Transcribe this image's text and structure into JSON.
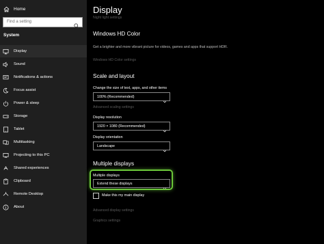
{
  "sidebar": {
    "home_label": "Home",
    "search_placeholder": "Find a setting",
    "section_title": "System",
    "items": [
      {
        "label": "Display",
        "icon": "monitor-icon"
      },
      {
        "label": "Sound",
        "icon": "speaker-icon"
      },
      {
        "label": "Notifications & actions",
        "icon": "notifications-icon"
      },
      {
        "label": "Focus assist",
        "icon": "moon-icon"
      },
      {
        "label": "Power & sleep",
        "icon": "power-icon"
      },
      {
        "label": "Storage",
        "icon": "storage-icon"
      },
      {
        "label": "Tablet",
        "icon": "tablet-icon"
      },
      {
        "label": "Multitasking",
        "icon": "multitasking-icon"
      },
      {
        "label": "Projecting to this PC",
        "icon": "projector-icon"
      },
      {
        "label": "Shared experiences",
        "icon": "shared-icon"
      },
      {
        "label": "Clipboard",
        "icon": "clipboard-icon"
      },
      {
        "label": "Remote Desktop",
        "icon": "remote-icon"
      },
      {
        "label": "About",
        "icon": "info-icon"
      }
    ]
  },
  "main": {
    "title": "Display",
    "night_light_link": "Night light settings",
    "hd_color": {
      "heading": "Windows HD Color",
      "description": "Get a brighter and more vibrant picture for videos, games and apps that support HDR.",
      "link": "Windows HD Color settings"
    },
    "scale": {
      "heading": "Scale and layout",
      "size_label": "Change the size of text, apps, and other items",
      "size_value": "100% (Recommended)",
      "advanced_link": "Advanced scaling settings",
      "resolution_label": "Display resolution",
      "resolution_value": "1920 × 1080 (Recommended)",
      "orientation_label": "Display orientation",
      "orientation_value": "Landscape"
    },
    "multiple": {
      "heading": "Multiple displays",
      "label": "Multiple displays",
      "value": "Extend these displays",
      "main_display_label": "Make this my main display",
      "main_display_checked": false,
      "advanced_link": "Advanced display settings",
      "graphics_link": "Graphics settings"
    }
  },
  "colors": {
    "highlight": "#6cc83a",
    "sidebar_bg": "#1f1f1f",
    "main_bg": "#000000"
  }
}
